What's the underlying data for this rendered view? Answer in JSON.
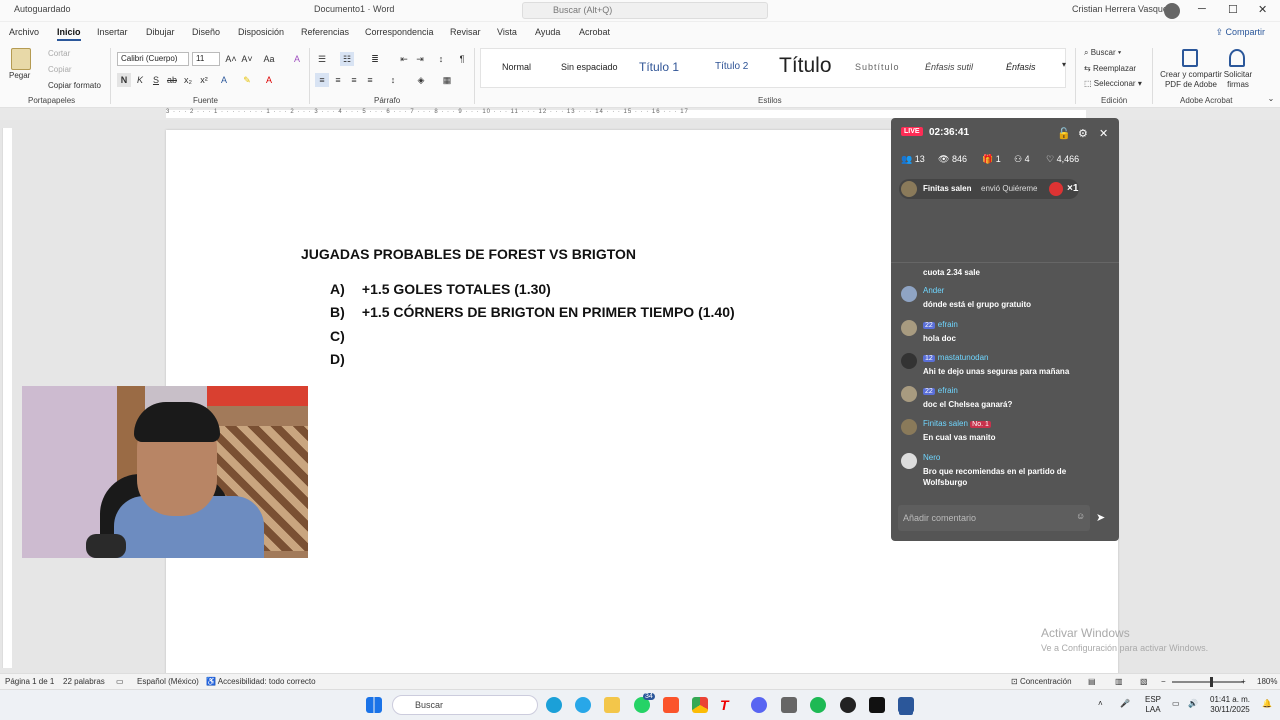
{
  "titlebar": {
    "autosave": "Autoguardado",
    "doc_name": "Documento1 · Word",
    "search_placeholder": "Buscar (Alt+Q)",
    "user": "Cristian Herrera Vasquez"
  },
  "menu": {
    "tabs": [
      "Archivo",
      "Inicio",
      "Insertar",
      "Dibujar",
      "Diseño",
      "Disposición",
      "Referencias",
      "Correspondencia",
      "Revisar",
      "Vista",
      "Ayuda",
      "Acrobat"
    ],
    "share": "Compartir"
  },
  "ribbon": {
    "clipboard": {
      "paste": "Pegar",
      "cut": "Cortar",
      "copy": "Copiar",
      "format_painter": "Copiar formato",
      "label": "Portapapeles"
    },
    "font": {
      "name": "Calibri (Cuerpo)",
      "size": "11",
      "label": "Fuente"
    },
    "paragraph": {
      "label": "Párrafo"
    },
    "styles": {
      "items": [
        "Normal",
        "Sin espaciado",
        "Título 1",
        "Título 2",
        "Título",
        "Subtítulo",
        "Énfasis sutil",
        "Énfasis"
      ],
      "label": "Estilos"
    },
    "editing": {
      "find": "Buscar",
      "replace": "Reemplazar",
      "select": "Seleccionar",
      "label": "Edición"
    },
    "acrobat": {
      "create_pdf": "Crear y compartir PDF de Adobe",
      "request_sign": "Solicitar firmas",
      "label": "Adobe Acrobat"
    }
  },
  "document": {
    "title": "JUGADAS PROBABLES DE FOREST VS BRIGTON",
    "options": [
      {
        "letter": "A)",
        "text": "+1.5 GOLES TOTALES (1.30)"
      },
      {
        "letter": "B)",
        "text": "+1.5 CÓRNERS DE BRIGTON EN PRIMER TIEMPO (1.40)"
      },
      {
        "letter": "C)",
        "text": ""
      },
      {
        "letter": "D)",
        "text": ""
      }
    ],
    "activate_title": "Activar Windows",
    "activate_sub": "Ve a Configuración para activar Windows."
  },
  "live": {
    "badge": "LIVE",
    "timer": "02:36:41",
    "stats": {
      "viewers": "13",
      "views": "846",
      "gifts": "1",
      "members": "4",
      "likes": "4,466"
    },
    "gift": {
      "user": "Finitas salen",
      "text": "envió Quiéreme",
      "count": "×1"
    },
    "messages": [
      {
        "name": "",
        "badge": "",
        "text": "cuota 2.34 sale"
      },
      {
        "name": "Ander",
        "badge": "",
        "text": "dónde está el grupo gratuito"
      },
      {
        "name": "efrain",
        "badge": "22",
        "text": "hola doc"
      },
      {
        "name": "mastatunodan",
        "badge": "12",
        "text": "Ahi te dejo unas seguras para mañana"
      },
      {
        "name": "efrain",
        "badge": "22",
        "text": "doc el Chelsea ganará?"
      },
      {
        "name": "Finitas salen",
        "badge": "No. 1",
        "text": "En cual vas manito"
      },
      {
        "name": "Nero",
        "badge": "",
        "text": "Bro que recomiendas en el partido de Wolfsburgo"
      }
    ],
    "comment_placeholder": "Añadir comentario"
  },
  "status": {
    "page": "Página 1 de 1",
    "words": "22 palabras",
    "language": "Español (México)",
    "accessibility": "Accesibilidad: todo correcto",
    "focus": "Concentración",
    "zoom": "180%"
  },
  "taskbar": {
    "search": "Buscar",
    "lang": "ESP",
    "lang2": "LAA",
    "time": "01:41 a. m.",
    "date": "30/11/2025",
    "whatsapp_badge": "34"
  },
  "colors": {
    "word_blue": "#2b579a",
    "live_red": "#fe2c55",
    "panel_bg": "#555555"
  }
}
